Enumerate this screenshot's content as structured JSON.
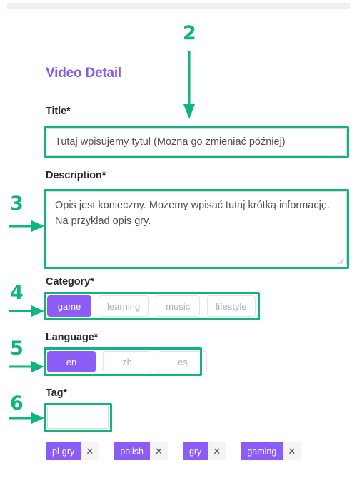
{
  "page": {
    "title": "Video Detail",
    "accent_purple": "#8b5cf6",
    "annotation_green": "#0fb57f",
    "label_color": "#25282b",
    "background": "#ffffff"
  },
  "fields": {
    "title": {
      "label": "Title*",
      "value": "Tutaj wpisujemy tytuł (Można go zmieniać później)",
      "placeholder": "Tutaj wpisujemy tytuł (Można go zmieniać później)"
    },
    "description": {
      "label": "Description*",
      "value": "Opis jest konieczny. Możemy wpisać tutaj krótką informację. Na przykład opis gry.",
      "placeholder": "Opis jest konieczny. Możemy wpisać tutaj krótką informację. Na przykład opis gry."
    },
    "category": {
      "label": "Category*",
      "options": [
        {
          "label": "game",
          "selected": true
        },
        {
          "label": "learning",
          "selected": false
        },
        {
          "label": "music",
          "selected": false
        },
        {
          "label": "lifestyle",
          "selected": false
        }
      ],
      "selected_value": "game"
    },
    "language": {
      "label": "Language*",
      "options": [
        {
          "label": "en",
          "selected": true
        },
        {
          "label": "zh",
          "selected": false
        },
        {
          "label": "es",
          "selected": false
        }
      ],
      "selected_value": "en"
    },
    "tag": {
      "label": "Tag*",
      "value": "",
      "placeholder": "",
      "chips": [
        {
          "label": "pl-gry",
          "remove_icon": "close-icon"
        },
        {
          "label": "polish",
          "remove_icon": "close-icon"
        },
        {
          "label": "gry",
          "remove_icon": "close-icon"
        },
        {
          "label": "gaming",
          "remove_icon": "close-icon"
        }
      ]
    }
  },
  "annotations": [
    {
      "number": "2",
      "target": "title-input",
      "direction": "down"
    },
    {
      "number": "3",
      "target": "description-textarea",
      "direction": "right"
    },
    {
      "number": "4",
      "target": "category-group",
      "direction": "right"
    },
    {
      "number": "5",
      "target": "language-group",
      "direction": "right"
    },
    {
      "number": "6",
      "target": "tag-input",
      "direction": "right"
    }
  ]
}
